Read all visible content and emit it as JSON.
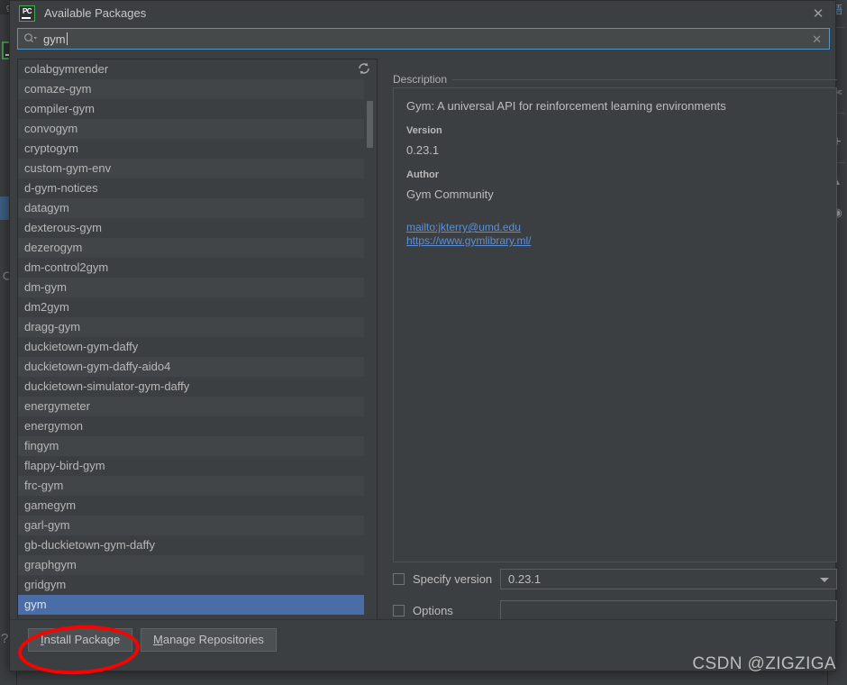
{
  "window": {
    "title": "Available Packages",
    "app_icon": "pycharm-icon",
    "close_icon": "close-icon"
  },
  "search": {
    "value": "gym",
    "placeholder": "",
    "icon": "search-icon",
    "clear_icon": "clear-icon"
  },
  "package_list": {
    "refresh_icon": "refresh-icon",
    "selected": "gym",
    "items": [
      "colabgymrender",
      "comaze-gym",
      "compiler-gym",
      "convogym",
      "cryptogym",
      "custom-gym-env",
      "d-gym-notices",
      "datagym",
      "dexterous-gym",
      "dezerogym",
      "dm-control2gym",
      "dm-gym",
      "dm2gym",
      "dragg-gym",
      "duckietown-gym-daffy",
      "duckietown-gym-daffy-aido4",
      "duckietown-simulator-gym-daffy",
      "energymeter",
      "energymon",
      "fingym",
      "flappy-bird-gym",
      "frc-gym",
      "gamegym",
      "garl-gym",
      "gb-duckietown-gym-daffy",
      "graphgym",
      "gridgym",
      "gym"
    ]
  },
  "description": {
    "panel_label": "Description",
    "summary": "Gym: A universal API for reinforcement learning environments",
    "version_label": "Version",
    "version_value": "0.23.1",
    "author_label": "Author",
    "author_value": "Gym Community",
    "links": [
      "mailto:jkterry@umd.edu",
      "https://www.gymlibrary.ml/"
    ]
  },
  "options": {
    "specify_version_label": "Specify version",
    "specify_version_checked": false,
    "version_value": "0.23.1",
    "options_label": "Options",
    "options_checked": false,
    "options_value": ""
  },
  "buttons": {
    "install": "Install Package",
    "install_mnemonic": "I",
    "install_rest": "nstall Package",
    "manage": "Manage Repositories",
    "manage_mnemonic": "M",
    "manage_rest": "anage Repositories"
  },
  "annotation": {
    "circle_color": "#fe0000",
    "target": "Install Package"
  },
  "watermark": "CSDN @ZIGZIGA",
  "ide_background": {
    "left_tabs": [
      "g"
    ],
    "right_icons": [
      "scissors-icon",
      "plus-icon",
      "collapse-icon",
      "record-icon"
    ],
    "right_top_icon": "cjk-toggle-icon"
  },
  "colors": {
    "dialog_bg": "#3c3f41",
    "selection": "#4a6da7",
    "link": "#5c8fd6",
    "focus_border": "#5394c8",
    "annotation": "#fe0000"
  }
}
